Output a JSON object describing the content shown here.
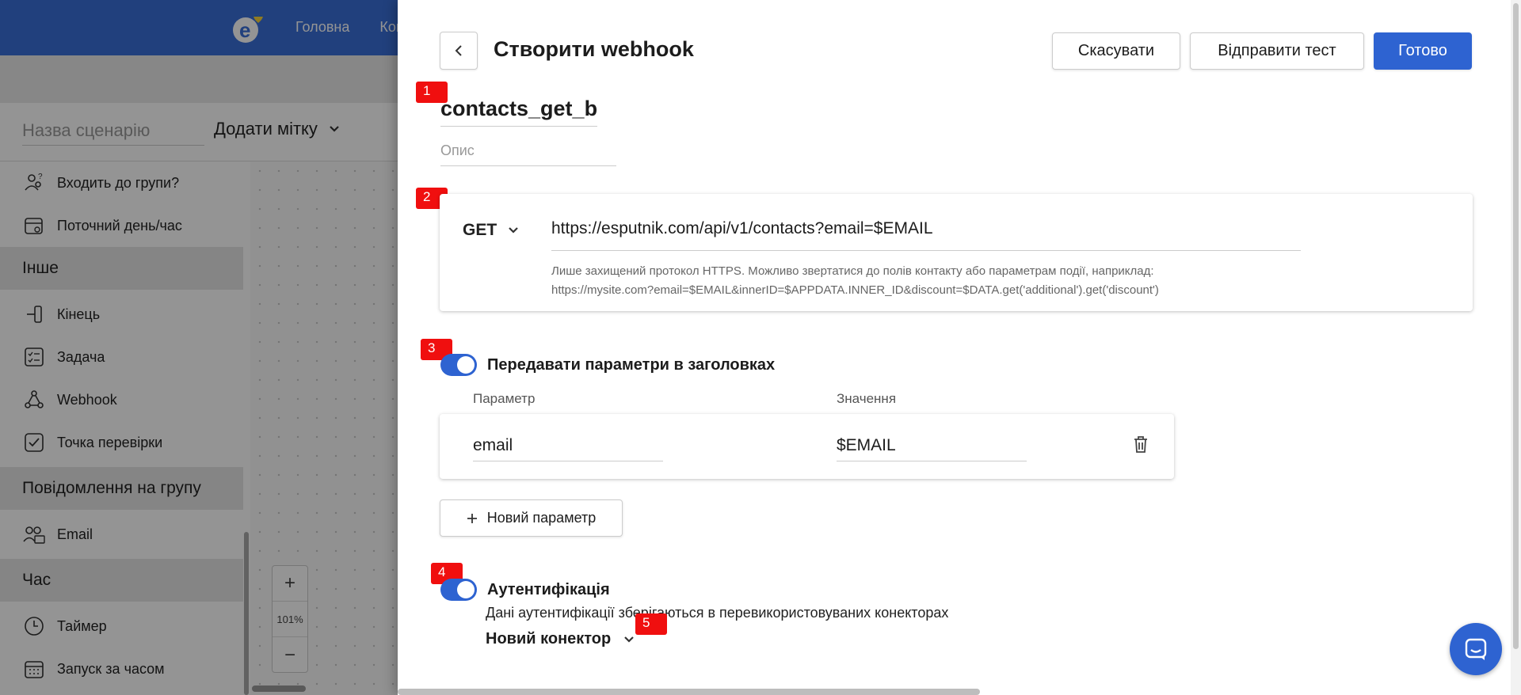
{
  "app": {
    "nav": [
      "Головна",
      "Кон"
    ],
    "scenario_name_placeholder": "Назва сценарію",
    "add_tag_label": "Додати мітку",
    "sidebar": {
      "items_top": [
        "Входить до групи?",
        "Поточний день/час"
      ],
      "section_other": "Інше",
      "items_other": [
        "Кінець",
        "Задача",
        "Webhook",
        "Точка перевірки"
      ],
      "section_group_message": "Повідомлення на групу",
      "items_group": [
        "Email"
      ],
      "section_time": "Час",
      "items_time": [
        "Таймер",
        "Запуск за часом"
      ]
    },
    "zoom": {
      "in": "+",
      "level": "101%",
      "out": "−"
    }
  },
  "drawer": {
    "title": "Створити webhook",
    "buttons": {
      "cancel": "Скасувати",
      "send_test": "Відправити тест",
      "done": "Готово"
    },
    "markers": [
      "1",
      "2",
      "3",
      "4",
      "5"
    ],
    "webhook_name": "contacts_get_b",
    "description_placeholder": "Опис",
    "method": "GET",
    "url": "https://esputnik.com/api/v1/contacts?email=$EMAIL",
    "hint_line1": "Лише захищений протокол HTTPS. Можливо звертатися до полів контакту або параметрам події, наприклад:",
    "hint_line2": "https://mysite.com?email=$EMAIL&innerID=$APPDATA.INNER_ID&discount=$DATA.get('additional').get('discount')",
    "headers_toggle": {
      "label": "Передавати параметри в заголовках",
      "on": true
    },
    "params": {
      "col_param": "Параметр",
      "col_value": "Значення",
      "rows": [
        {
          "param": "email",
          "value": "$EMAIL"
        }
      ],
      "new_param_label": "Новий параметр"
    },
    "auth": {
      "label": "Аутентифікація",
      "on": true,
      "note": "Дані аутентифікації зберігаються в перевикористовуваних конекторах",
      "connector_label": "Новий конектор"
    }
  },
  "colors": {
    "primary": "#2e63d1",
    "topbar": "#3a6fd8",
    "marker": "#f00f0f"
  }
}
